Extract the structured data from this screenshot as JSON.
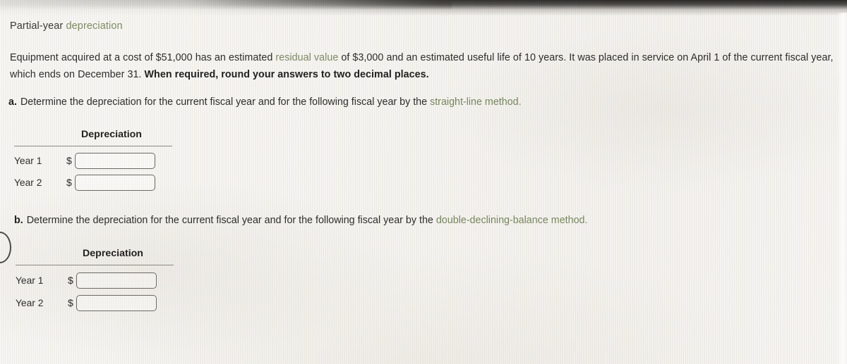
{
  "document": {
    "title_plain": "Partial-year ",
    "title_accent": "depreciation"
  },
  "prompt": {
    "seg1": "Equipment acquired at a cost of $51,000 has an estimated ",
    "seg2_accent": "residual value",
    "seg3": " of $3,000 and an estimated useful life of 10 years. It was placed in service on April 1 of the current fiscal year, which ends on December 31. ",
    "seg4_bold": "When required, round your answers to two decimal places."
  },
  "parts": [
    {
      "letter": "a.",
      "text": "Determine the depreciation for the current fiscal year and for the following fiscal year by the ",
      "method_accent": "straight-line method."
    },
    {
      "letter": "b.",
      "text": "Determine the depreciation for the current fiscal year and for the following fiscal year by the ",
      "method_accent": "double-declining-balance method."
    }
  ],
  "tables": [
    {
      "column_header": "Depreciation",
      "currency_symbol": "$",
      "rows": [
        {
          "label": "Year 1",
          "value": "",
          "placeholder": ""
        },
        {
          "label": "Year 2",
          "value": "",
          "placeholder": ""
        }
      ]
    },
    {
      "column_header": "Depreciation",
      "currency_symbol": "$",
      "rows": [
        {
          "label": "Year 1",
          "value": "",
          "placeholder": ""
        },
        {
          "label": "Year 2",
          "value": "",
          "placeholder": ""
        }
      ]
    }
  ],
  "colors": {
    "accent_green": "#7d8a64",
    "body_text": "#2e2d2b",
    "paper": "#f1efea",
    "rule": "#8b8880",
    "input_border": "#6d6a64"
  }
}
